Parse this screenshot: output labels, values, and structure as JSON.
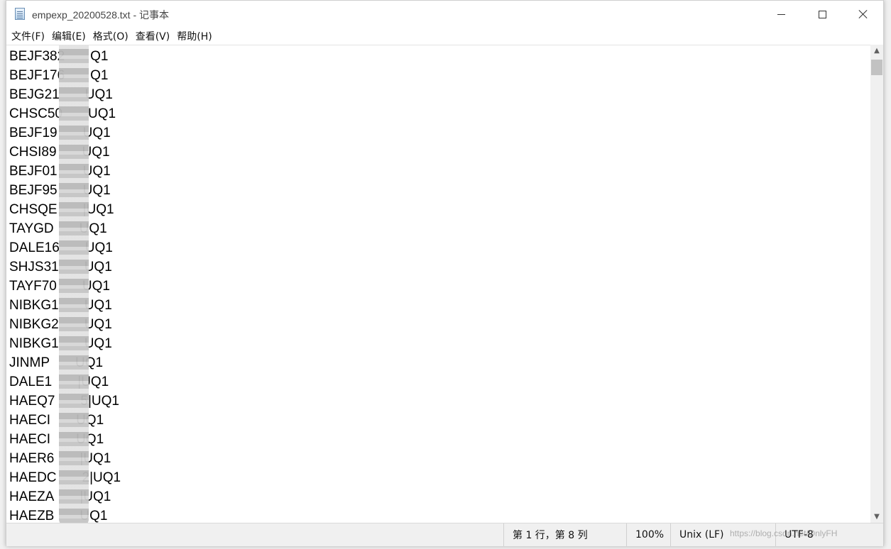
{
  "window": {
    "title": "empexp_20200528.txt - 记事本",
    "icon": "notepad-icon"
  },
  "menu": [
    "文件(F)",
    "编辑(E)",
    "格式(O)",
    "查看(V)",
    "帮助(H)"
  ],
  "lines": [
    "BEJF382",
    "BEJF176",
    "BEJG21",
    "CHSC50",
    "BEJF19",
    "CHSI89",
    "BEJF01",
    "BEJF95",
    "CHSQE",
    "TAYGD",
    "DALE16",
    "SHJS31",
    "TAYF70",
    "NIBKG1",
    "NIBKG2",
    "NIBKG1",
    "JINMP",
    "DALE1",
    "HAEQ7",
    "HAECI",
    "HAECI",
    "HAER6",
    "HAEDC",
    "HAEZA",
    "HAEZB"
  ],
  "line_suffixes": [
    "Q1",
    "Q1",
    "UQ1",
    "UQ1",
    "UQ1",
    "UQ1",
    "UQ1",
    "UQ1",
    "|UQ1",
    "UQ1",
    "UQ1",
    "UQ1",
    "UQ1",
    "UQ1",
    "UQ1",
    "UQ1",
    "UQ1",
    "|UQ1",
    "5|UQ1",
    "UQ1",
    "UQ1",
    "|UQ1",
    "2|UQ1",
    "|UQ1",
    "UQ1"
  ],
  "status": {
    "position": "第 1 行，第 8 列",
    "zoom": "100%",
    "line_ending": "Unix (LF)",
    "encoding": "UTF-8"
  },
  "watermark": "https://blog.csdn.net/OnlyFH"
}
